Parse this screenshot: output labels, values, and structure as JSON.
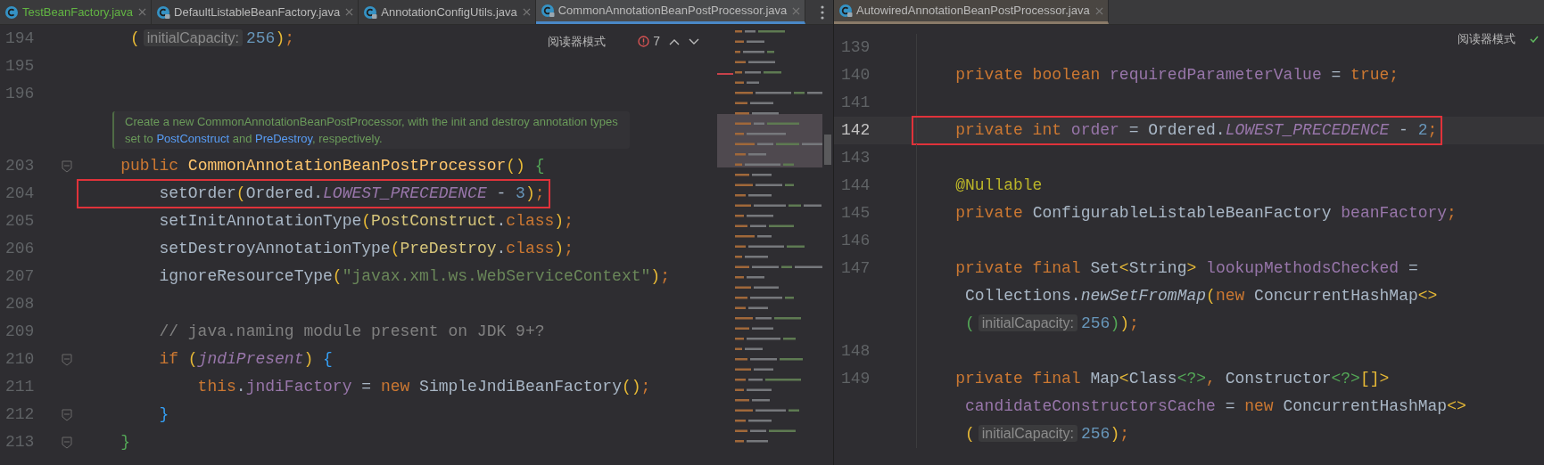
{
  "left_pane": {
    "focused": true,
    "tabs": [
      {
        "label": "TestBeanFactory.java",
        "selected": false,
        "locked": false,
        "color": "#62b543"
      },
      {
        "label": "DefaultListableBeanFactory.java",
        "selected": false,
        "locked": true,
        "color": "#bbbbbb"
      },
      {
        "label": "AnnotationConfigUtils.java",
        "selected": false,
        "locked": true,
        "color": "#bbbbbb"
      },
      {
        "label": "CommonAnnotationBeanPostProcessor.java",
        "selected": true,
        "locked": true,
        "color": "#bbbbbb"
      }
    ],
    "toolbar": {
      "reader_mode": "阅读器模式",
      "error_count": "7"
    },
    "lines_before": [
      {
        "number": "194",
        "tokens": [
          {
            "kind": "b1",
            "text": "     ("
          },
          {
            "kind": "hint",
            "text": "initialCapacity:"
          },
          {
            "kind": "num",
            "text": "256"
          },
          {
            "kind": "b1",
            "text": ")"
          },
          {
            "kind": "kw",
            "text": ";"
          }
        ]
      },
      {
        "number": "195"
      },
      {
        "number": "196"
      }
    ],
    "doc": [
      [
        {
          "kind": "text",
          "text": "Create a new CommonAnnotationBeanPostProcessor, with the init and destroy annotation types"
        }
      ],
      [
        {
          "kind": "text",
          "text": "set to "
        },
        {
          "kind": "link",
          "text": "PostConstruct"
        },
        {
          "kind": "text",
          "text": " and "
        },
        {
          "kind": "link",
          "text": "PreDestroy"
        },
        {
          "kind": "text",
          "text": ", respectively."
        }
      ]
    ],
    "lines_after": [
      {
        "number": "203",
        "fold": true,
        "tokens": [
          {
            "kind": "kw",
            "text": "    public "
          },
          {
            "kind": "method",
            "text": "CommonAnnotationBeanPostProcessor"
          },
          {
            "kind": "b1",
            "text": "() "
          },
          {
            "kind": "b2",
            "text": "{"
          }
        ]
      },
      {
        "number": "204",
        "highlighted": true,
        "tokens": [
          {
            "kind": "plain",
            "text": "        setOrder"
          },
          {
            "kind": "b1",
            "text": "("
          },
          {
            "kind": "plain",
            "text": "Ordered."
          },
          {
            "kind": "static",
            "text": "LOWEST_PRECEDENCE"
          },
          {
            "kind": "plain",
            "text": " - "
          },
          {
            "kind": "num",
            "text": "3"
          },
          {
            "kind": "b1",
            "text": ")"
          },
          {
            "kind": "kw",
            "text": ";"
          }
        ]
      },
      {
        "number": "205",
        "tokens": [
          {
            "kind": "plain",
            "text": "        setInitAnnotationType"
          },
          {
            "kind": "b1",
            "text": "("
          },
          {
            "kind": "type",
            "text": "PostConstruct"
          },
          {
            "kind": "plain",
            "text": "."
          },
          {
            "kind": "kw",
            "text": "class"
          },
          {
            "kind": "b1",
            "text": ")"
          },
          {
            "kind": "kw",
            "text": ";"
          }
        ]
      },
      {
        "number": "206",
        "tokens": [
          {
            "kind": "plain",
            "text": "        setDestroyAnnotationType"
          },
          {
            "kind": "b1",
            "text": "("
          },
          {
            "kind": "type",
            "text": "PreDestroy"
          },
          {
            "kind": "plain",
            "text": "."
          },
          {
            "kind": "kw",
            "text": "class"
          },
          {
            "kind": "b1",
            "text": ")"
          },
          {
            "kind": "kw",
            "text": ";"
          }
        ]
      },
      {
        "number": "207",
        "tokens": [
          {
            "kind": "plain",
            "text": "        ignoreResourceType"
          },
          {
            "kind": "b1",
            "text": "("
          },
          {
            "kind": "str",
            "text": "\"javax.xml.ws.WebServiceContext\""
          },
          {
            "kind": "b1",
            "text": ")"
          },
          {
            "kind": "kw",
            "text": ";"
          }
        ]
      },
      {
        "number": "208"
      },
      {
        "number": "209",
        "tokens": [
          {
            "kind": "comment",
            "text": "        // java.naming module present on JDK 9+?"
          }
        ]
      },
      {
        "number": "210",
        "fold": true,
        "tokens": [
          {
            "kind": "kw",
            "text": "        if "
          },
          {
            "kind": "b1",
            "text": "("
          },
          {
            "kind": "static",
            "text": "jndiPresent"
          },
          {
            "kind": "b1",
            "text": ") "
          },
          {
            "kind": "b3",
            "text": "{"
          }
        ]
      },
      {
        "number": "211",
        "tokens": [
          {
            "kind": "kw",
            "text": "            this"
          },
          {
            "kind": "plain",
            "text": "."
          },
          {
            "kind": "field",
            "text": "jndiFactory"
          },
          {
            "kind": "plain",
            "text": " = "
          },
          {
            "kind": "kw",
            "text": "new "
          },
          {
            "kind": "plain",
            "text": "SimpleJndiBeanFactory"
          },
          {
            "kind": "b1",
            "text": "()"
          },
          {
            "kind": "kw",
            "text": ";"
          }
        ]
      },
      {
        "number": "212",
        "fold": true,
        "tokens": [
          {
            "kind": "b3",
            "text": "        }"
          }
        ]
      },
      {
        "number": "213",
        "fold": true,
        "tokens": [
          {
            "kind": "b2",
            "text": "    }"
          }
        ]
      }
    ]
  },
  "right_pane": {
    "focused": false,
    "tabs": [
      {
        "label": "AutowiredAnnotationBeanPostProcessor.java",
        "selected": true,
        "locked": true,
        "color": "#bbbbbb"
      }
    ],
    "toolbar": {
      "reader_mode": "阅读器模式"
    },
    "lines": [
      {
        "number": "139"
      },
      {
        "number": "140",
        "tokens": [
          {
            "kind": "kw",
            "text": "    private boolean "
          },
          {
            "kind": "field",
            "text": "requiredParameterValue"
          },
          {
            "kind": "plain",
            "text": " = "
          },
          {
            "kind": "kw",
            "text": "true;"
          }
        ]
      },
      {
        "number": "141"
      },
      {
        "number": "142",
        "current": true,
        "highlighted": true,
        "tokens": [
          {
            "kind": "kw",
            "text": "    private int "
          },
          {
            "kind": "field",
            "text": "order"
          },
          {
            "kind": "plain",
            "text": " = Ordered."
          },
          {
            "kind": "static",
            "text": "LOWEST_PRECEDENCE"
          },
          {
            "kind": "plain",
            "text": " - "
          },
          {
            "kind": "num",
            "text": "2"
          },
          {
            "kind": "kw",
            "text": ";"
          }
        ]
      },
      {
        "number": "143"
      },
      {
        "number": "144",
        "tokens": [
          {
            "kind": "ann",
            "text": "    @Nullable"
          }
        ]
      },
      {
        "number": "145",
        "tokens": [
          {
            "kind": "kw",
            "text": "    private "
          },
          {
            "kind": "plain",
            "text": "ConfigurableListableBeanFactory "
          },
          {
            "kind": "field",
            "text": "beanFactory"
          },
          {
            "kind": "kw",
            "text": ";"
          }
        ]
      },
      {
        "number": "146"
      },
      {
        "number": "147",
        "tokens": [
          {
            "kind": "kw",
            "text": "    private final "
          },
          {
            "kind": "plain",
            "text": "Set"
          },
          {
            "kind": "b1",
            "text": "<"
          },
          {
            "kind": "plain",
            "text": "String"
          },
          {
            "kind": "b1",
            "text": "> "
          },
          {
            "kind": "field",
            "text": "lookupMethodsChecked"
          },
          {
            "kind": "plain",
            "text": " ="
          }
        ]
      },
      {
        "tokens": [
          {
            "kind": "plain",
            "text": "     Collections."
          },
          {
            "kind": "call",
            "text": "newSetFromMap"
          },
          {
            "kind": "b1",
            "text": "("
          },
          {
            "kind": "kw",
            "text": "new "
          },
          {
            "kind": "plain",
            "text": "ConcurrentHashMap"
          },
          {
            "kind": "b1",
            "text": "<>"
          }
        ]
      },
      {
        "tokens": [
          {
            "kind": "b2",
            "text": "     ("
          },
          {
            "kind": "hint",
            "text": "initialCapacity:"
          },
          {
            "kind": "num",
            "text": "256"
          },
          {
            "kind": "b2",
            "text": ")"
          },
          {
            "kind": "b1",
            "text": ")"
          },
          {
            "kind": "kw",
            "text": ";"
          }
        ]
      },
      {
        "number": "148"
      },
      {
        "number": "149",
        "tokens": [
          {
            "kind": "kw",
            "text": "    private final "
          },
          {
            "kind": "plain",
            "text": "Map"
          },
          {
            "kind": "b1",
            "text": "<"
          },
          {
            "kind": "plain",
            "text": "Class"
          },
          {
            "kind": "b2",
            "text": "<?>"
          },
          {
            "kind": "kw",
            "text": ", "
          },
          {
            "kind": "plain",
            "text": "Constructor"
          },
          {
            "kind": "b2",
            "text": "<?>"
          },
          {
            "kind": "b1",
            "text": "[]>"
          }
        ]
      },
      {
        "tokens": [
          {
            "kind": "field",
            "text": "     candidateConstructorsCache"
          },
          {
            "kind": "plain",
            "text": " = "
          },
          {
            "kind": "kw",
            "text": "new "
          },
          {
            "kind": "plain",
            "text": "ConcurrentHashMap"
          },
          {
            "kind": "b1",
            "text": "<>"
          }
        ]
      },
      {
        "tokens": [
          {
            "kind": "b1",
            "text": "     ("
          },
          {
            "kind": "hint",
            "text": "initialCapacity:"
          },
          {
            "kind": "num",
            "text": "256"
          },
          {
            "kind": "b1",
            "text": ")"
          },
          {
            "kind": "kw",
            "text": ";"
          }
        ]
      }
    ]
  }
}
